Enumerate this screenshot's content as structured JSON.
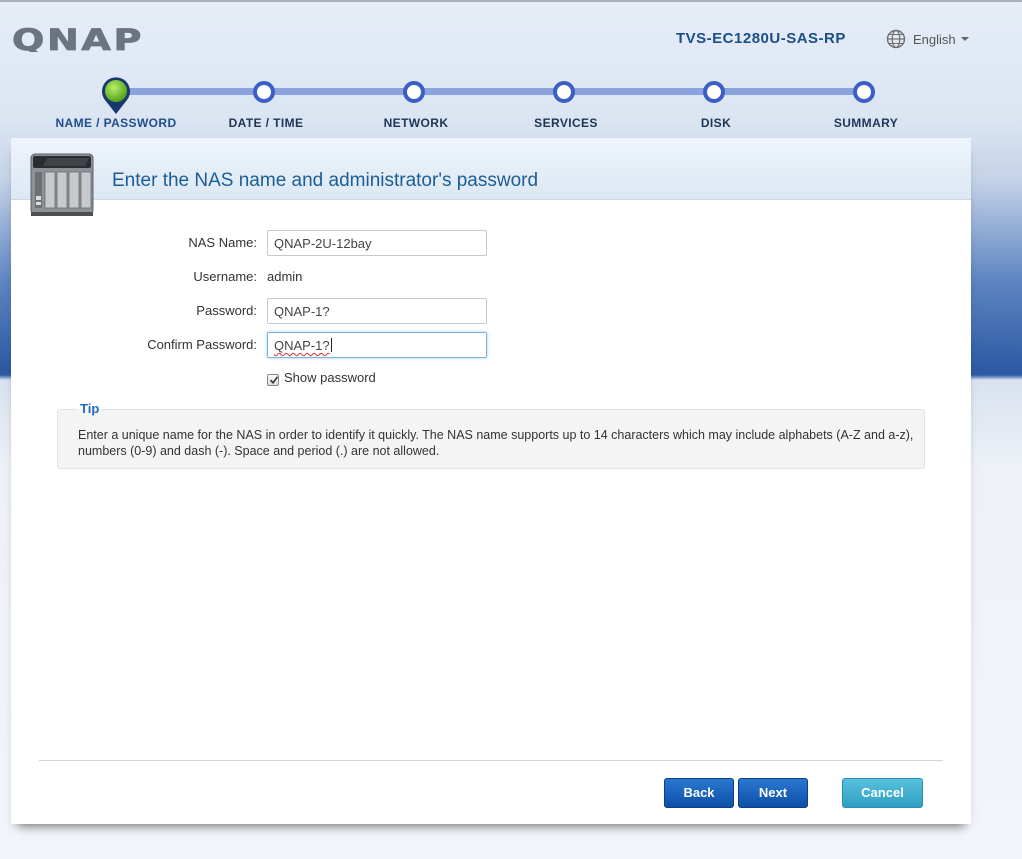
{
  "header": {
    "logo_text": "QNAP",
    "model": "TVS-EC1280U-SAS-RP",
    "language": "English",
    "language_icon": "globe-icon"
  },
  "steps": [
    {
      "label": "NAME / PASSWORD",
      "active": true
    },
    {
      "label": "DATE / TIME",
      "active": false
    },
    {
      "label": "NETWORK",
      "active": false
    },
    {
      "label": "SERVICES",
      "active": false
    },
    {
      "label": "DISK",
      "active": false
    },
    {
      "label": "SUMMARY",
      "active": false
    }
  ],
  "page": {
    "title": "Enter the NAS name and administrator's password",
    "icon": "nas-device-icon"
  },
  "form": {
    "nas_name_label": "NAS Name:",
    "nas_name_value": "QNAP-2U-12bay",
    "username_label": "Username:",
    "username_value": "admin",
    "password_label": "Password:",
    "password_value": "QNAP-1?",
    "confirm_label": "Confirm Password:",
    "confirm_value": "QNAP-1?",
    "show_password_label": "Show password",
    "show_password_checked": true
  },
  "tip": {
    "title": "Tip",
    "text": "Enter a unique name for the NAS in order to identify it quickly. The NAS name supports up to 14 characters which may include alphabets (A-Z and a-z), numbers (0-9) and dash (-). Space and period (.) are not allowed."
  },
  "buttons": {
    "back": "Back",
    "next": "Next",
    "cancel": "Cancel"
  },
  "colors": {
    "accent": "#1b4f86",
    "stepper": "#3b5fc9",
    "button_primary": "#0d4fa7",
    "button_cancel": "#2f9fc2"
  }
}
